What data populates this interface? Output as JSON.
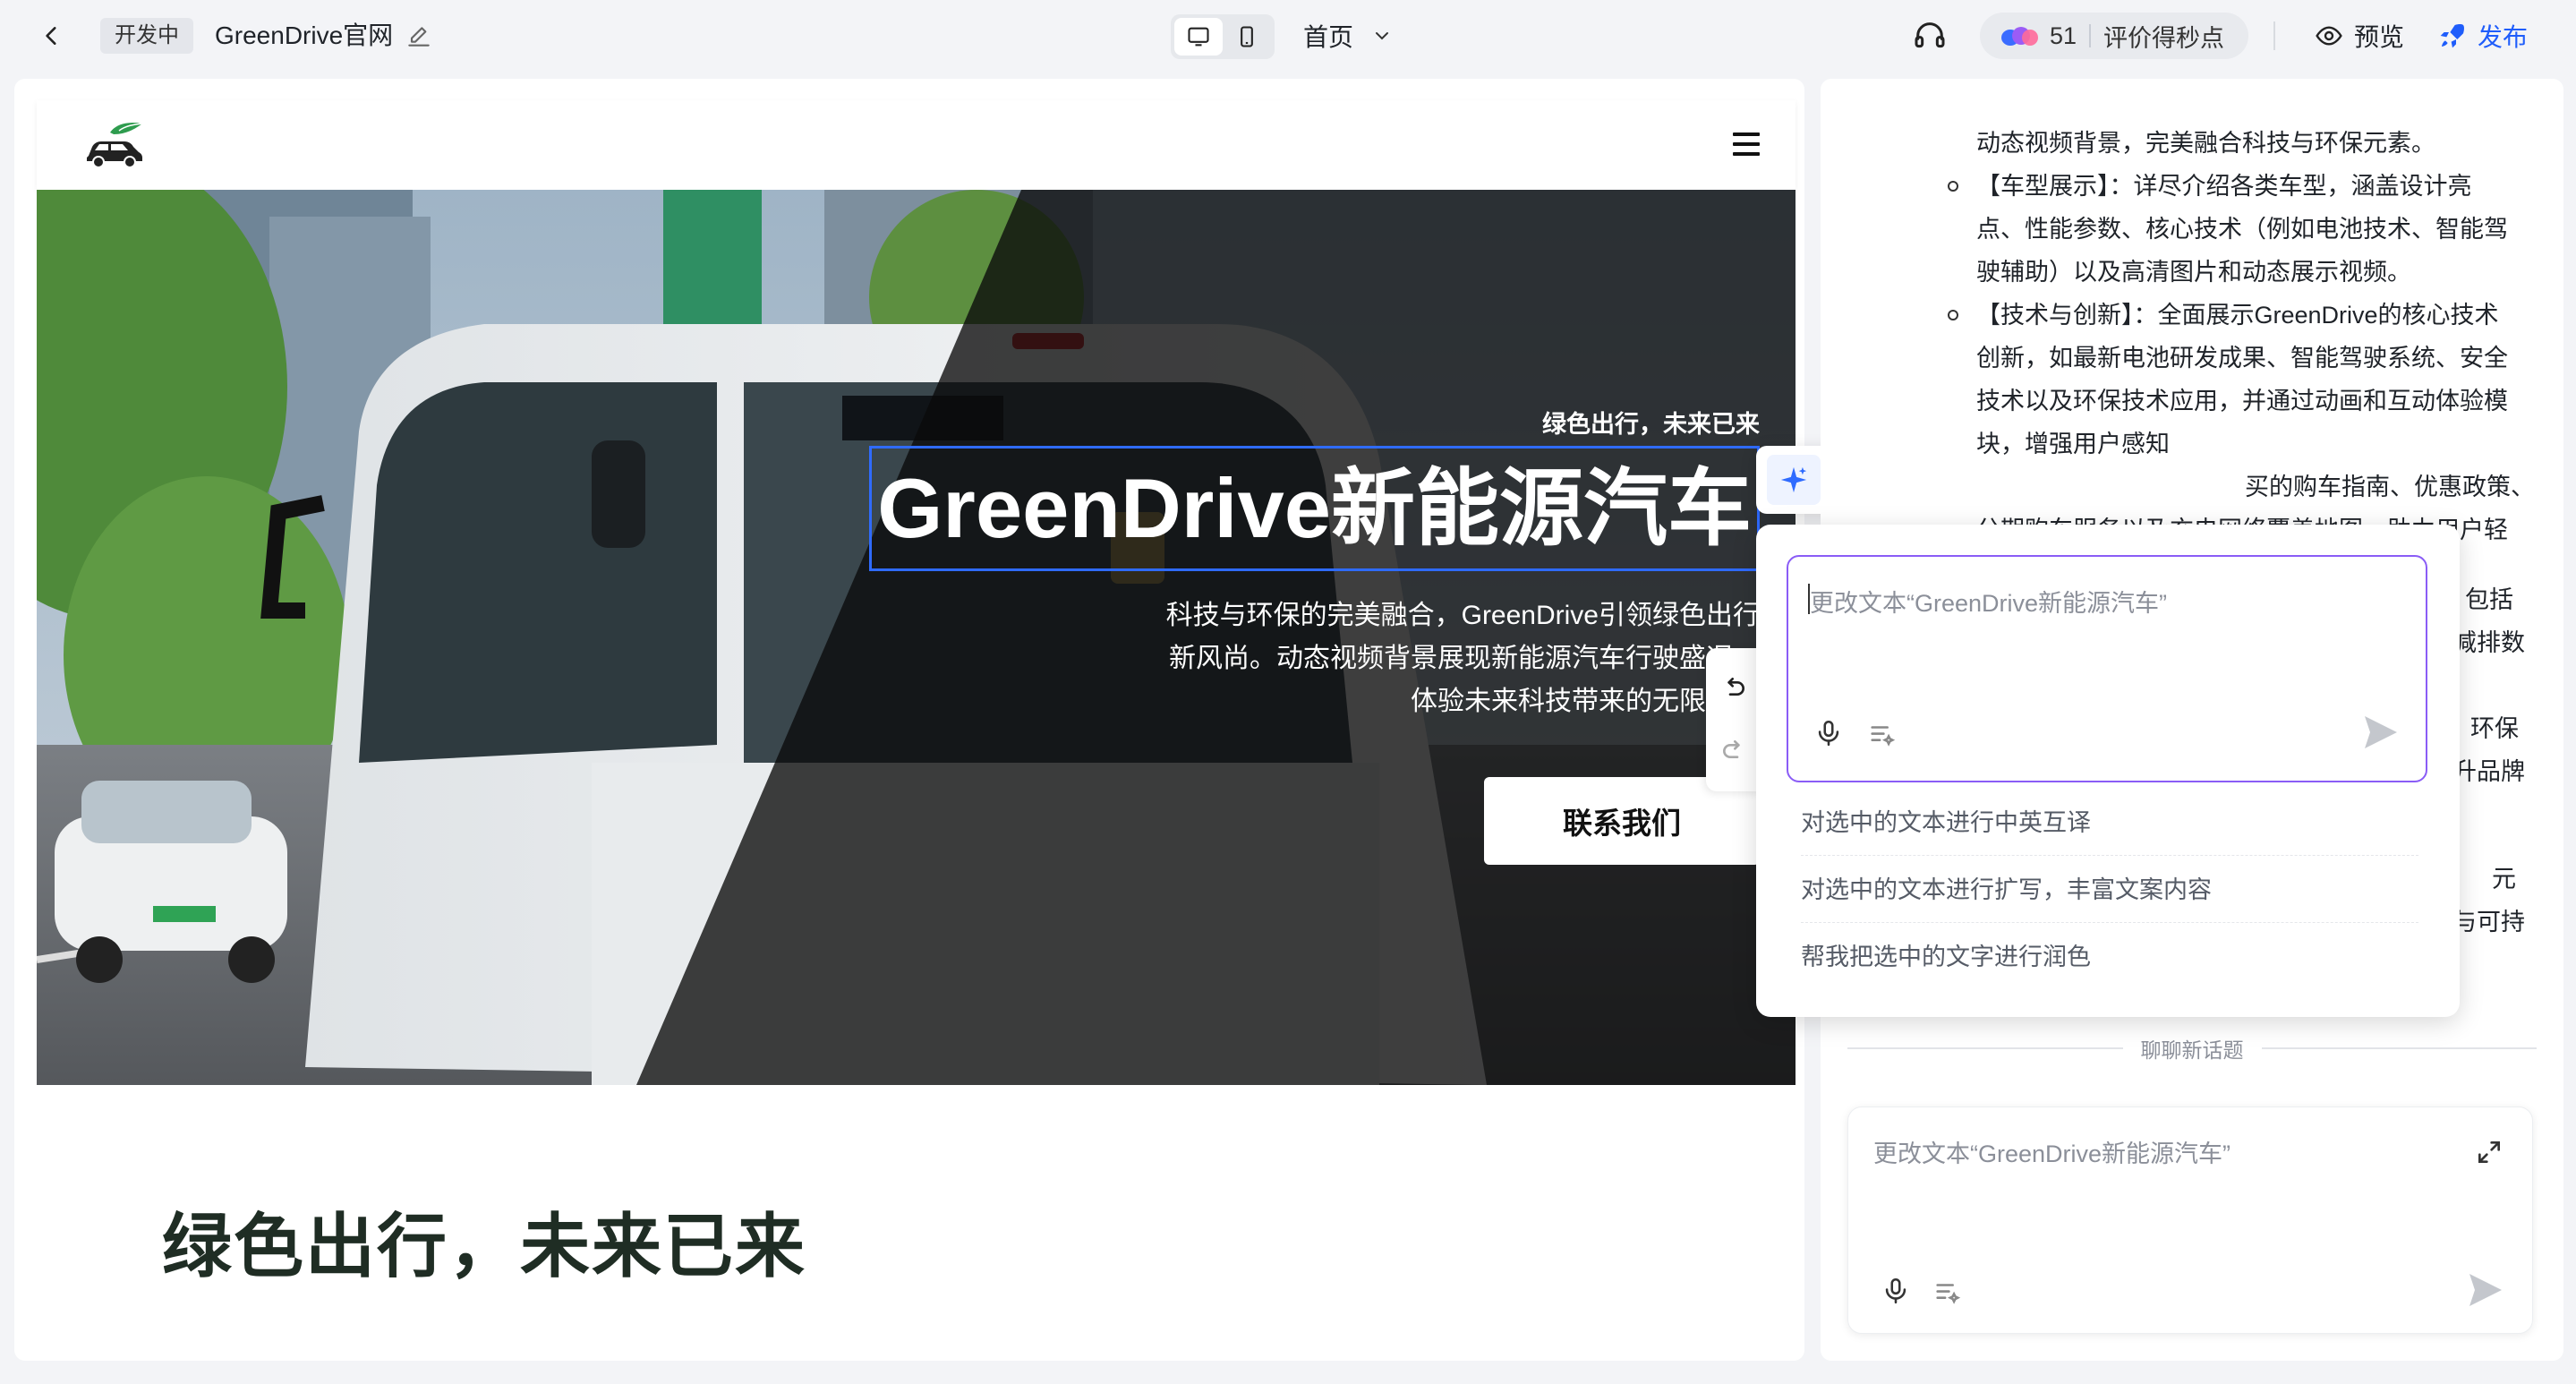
{
  "topbar": {
    "status_badge": "开发中",
    "project_title": "GreenDrive官网",
    "page_select": "首页",
    "score_count": "51",
    "score_label": "评价得秒点",
    "preview_label": "预览",
    "publish_label": "发布",
    "accent_color": "#1f5dfb"
  },
  "site": {
    "hero": {
      "tagline": "绿色出行，未来已来",
      "title": "GreenDrive新能源汽车",
      "description_lines": [
        "科技与环保的完美融合，GreenDrive引领绿色出行",
        "新风尚。动态视频背景展现新能源汽车行驶盛况，",
        "体验未来科技带来的无限可能"
      ],
      "cta_label": "联系我们"
    },
    "section_heading": "绿色出行，未来已来"
  },
  "toolbar": {
    "icons": [
      "ai-sparkle-icon",
      "text-type-icon",
      "font-color-icon",
      "link-icon",
      "copy-icon",
      "delete-icon",
      "more-icon"
    ]
  },
  "ai_popup": {
    "placeholder": "更改文本“GreenDrive新能源汽车”",
    "suggestions": [
      "对选中的文本进行中英互译",
      "对选中的文本进行扩写，丰富文案内容",
      "帮我把选中的文字进行润色"
    ]
  },
  "chat": {
    "lines": [
      "动态视频背景，完美融合科技与环保元素。",
      "【车型展示】：详尽介绍各类车型，涵盖设计亮",
      "点、性能参数、核心技术（例如电池技术、智能驾",
      "驶辅助）以及高清图片和动态展示视频。",
      "【技术与创新】：全面展示GreenDrive的核心技术",
      "创新，如最新电池研发成果、智能驾驶系统、安全",
      "技术以及环保技术应用，并通过动画和互动体验模",
      "块，增强用户感知",
      "买的购车指南、优惠政策、",
      "分期购车服务以及充电网络覆盖地图，助力用户轻",
      "包括",
      "减排数",
      "环保",
      "升品牌",
      "元",
      "与可持"
    ],
    "divider_label": "聊聊新话题",
    "input_placeholder": "更改文本“GreenDrive新能源汽车”"
  }
}
